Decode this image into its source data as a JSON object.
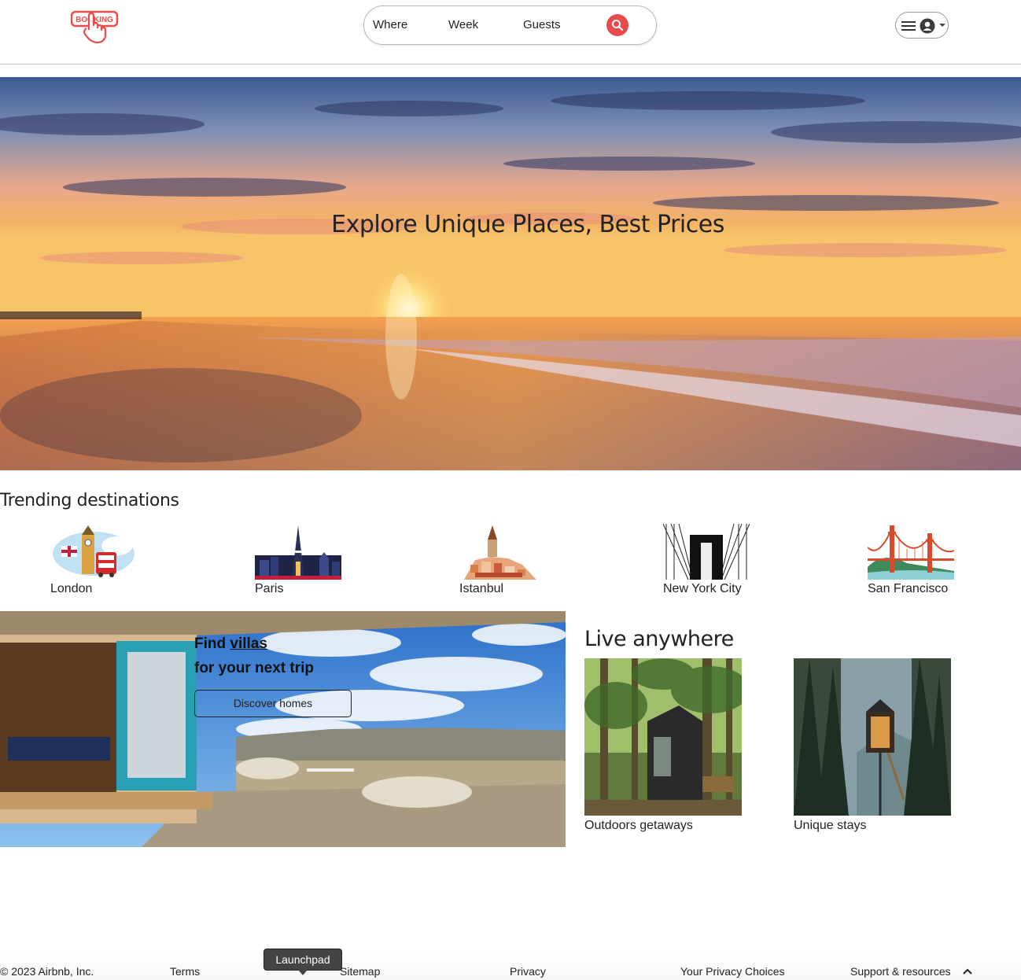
{
  "header": {
    "logo_text": "BOOKING",
    "search": {
      "where_label": "Where",
      "week_label": "Week",
      "guests_label": "Guests"
    },
    "accent_color": "#e94b4b"
  },
  "hero": {
    "title": "Explore Unique Places, Best Prices"
  },
  "trending": {
    "title": "Trending destinations",
    "items": [
      {
        "label": "London",
        "icon": "london-illustration"
      },
      {
        "label": "Paris",
        "icon": "paris-illustration"
      },
      {
        "label": "Istanbul",
        "icon": "istanbul-illustration"
      },
      {
        "label": "New York City",
        "icon": "brooklyn-bridge-photo"
      },
      {
        "label": "San Francisco",
        "icon": "golden-gate-illustration"
      }
    ]
  },
  "villas": {
    "find_prefix": "Find",
    "find_link": "villas",
    "subtitle": "for your next trip",
    "button_label": "Discover homes"
  },
  "live": {
    "title": "Live anywhere",
    "cards": [
      {
        "label": "Outdoors getaways"
      },
      {
        "label": "Unique stays"
      }
    ]
  },
  "footer": {
    "copyright": "© 2023 Airbnb, Inc.",
    "links": [
      "Terms",
      "Sitemap",
      "Privacy",
      "Your Privacy Choices",
      "Support & resources"
    ],
    "tooltip": "Launchpad"
  }
}
